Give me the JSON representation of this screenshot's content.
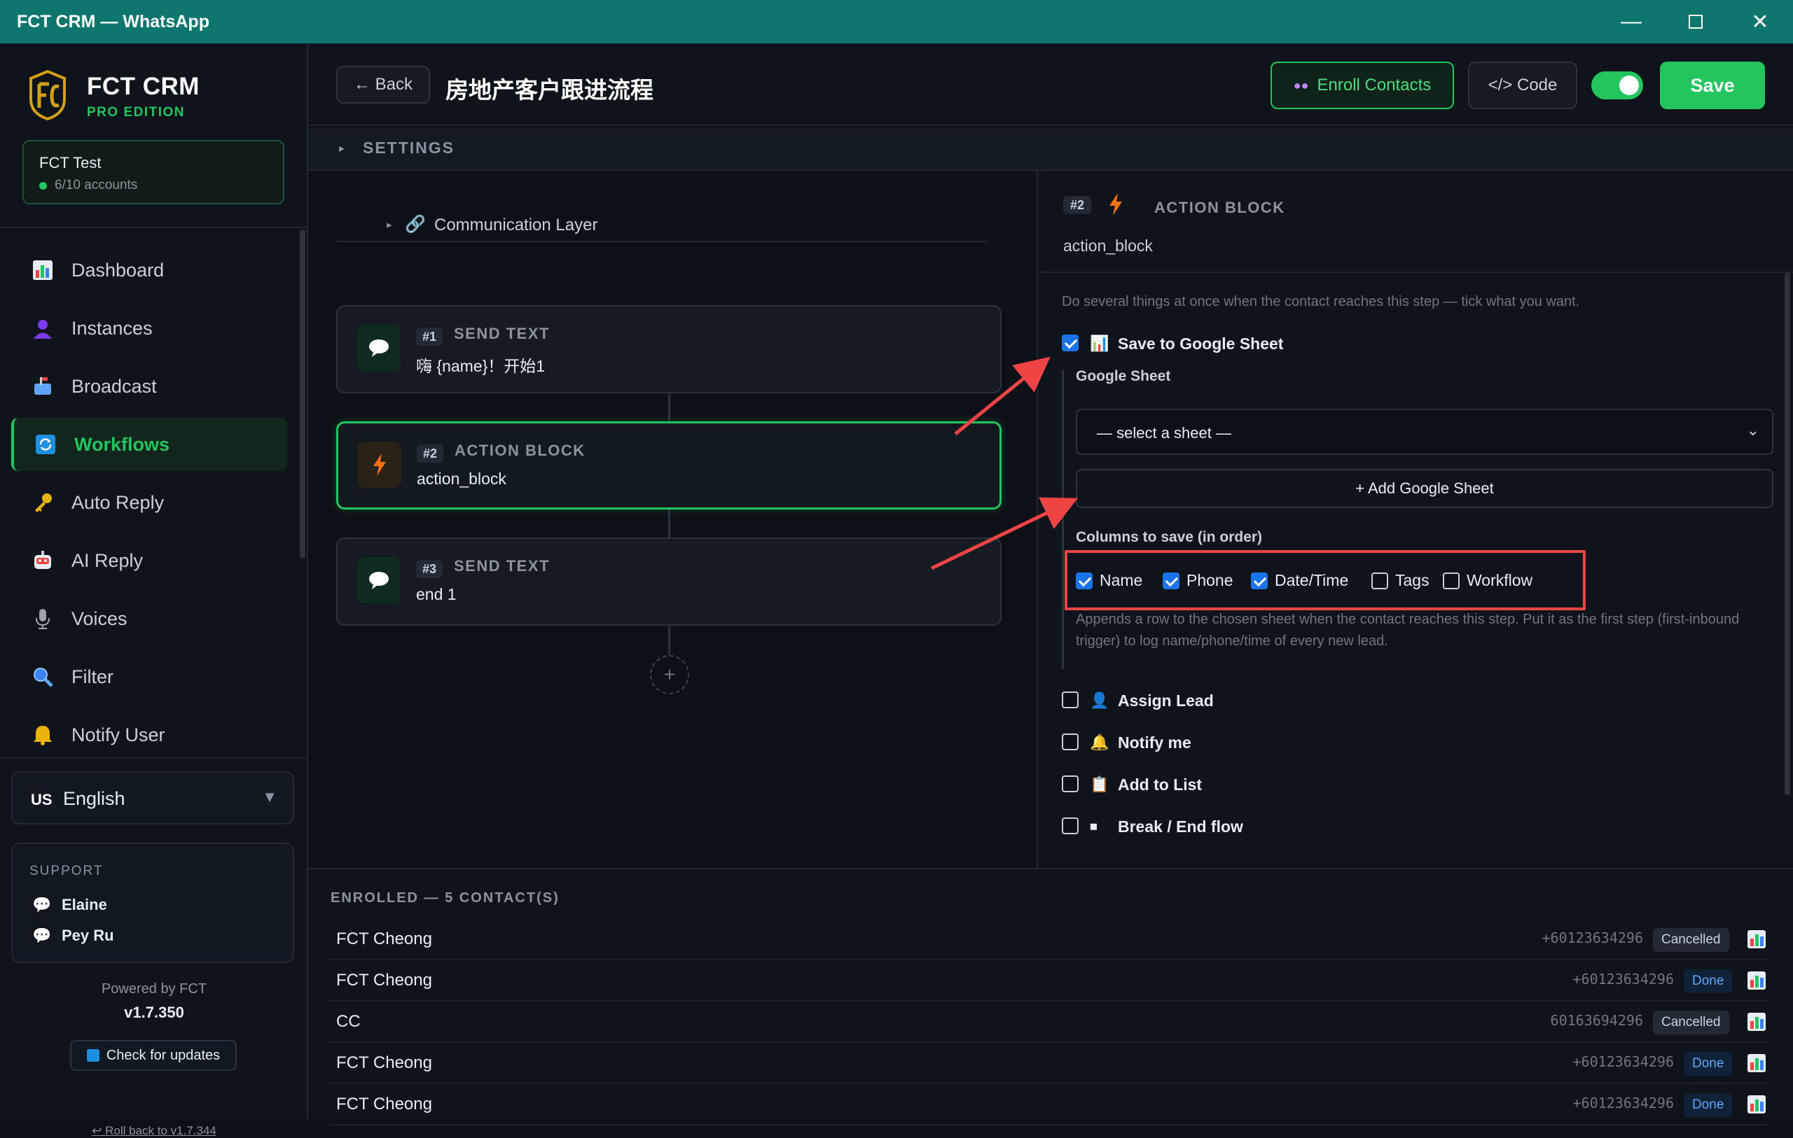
{
  "window": {
    "title": "FCT CRM — WhatsApp"
  },
  "brand": {
    "name": "FCT CRM",
    "edition": "PRO EDITION"
  },
  "account": {
    "name": "FCT Test",
    "count": "6/10 accounts"
  },
  "nav": [
    {
      "label": "Dashboard",
      "icon": "chart-icon"
    },
    {
      "label": "Instances",
      "icon": "user-icon"
    },
    {
      "label": "Broadcast",
      "icon": "mailbox-icon"
    },
    {
      "label": "Workflows",
      "icon": "refresh-icon"
    },
    {
      "label": "Auto Reply",
      "icon": "key-icon"
    },
    {
      "label": "AI Reply",
      "icon": "robot-icon"
    },
    {
      "label": "Voices",
      "icon": "microphone-icon"
    },
    {
      "label": "Filter",
      "icon": "magnifier-icon"
    },
    {
      "label": "Notify User",
      "icon": "bell-icon"
    }
  ],
  "language": {
    "flag": "US",
    "label": "English"
  },
  "support": {
    "heading": "SUPPORT",
    "people": [
      "Elaine",
      "Pey Ru"
    ]
  },
  "footer": {
    "powered": "Powered by FCT",
    "version": "v1.7.350",
    "check_updates": "Check for updates",
    "rollback": "↩ Roll back to v1.7.344"
  },
  "header": {
    "back_label": "← Back",
    "workflow_title": "房地产客户跟进流程",
    "enroll_label": "Enroll Contacts",
    "code_label": "</> Code",
    "save_label": "Save",
    "enabled": true
  },
  "settings": {
    "label": "SETTINGS"
  },
  "canvas": {
    "comm_layer": "Communication Layer",
    "nodes": [
      {
        "num": "#1",
        "type": "SEND TEXT",
        "text": "嗨 {name}！开始1"
      },
      {
        "num": "#2",
        "type": "ACTION BLOCK",
        "text": "action_block"
      },
      {
        "num": "#3",
        "type": "SEND TEXT",
        "text": "end 1"
      }
    ],
    "add_symbol": "+"
  },
  "panel": {
    "num": "#2",
    "type": "ACTION BLOCK",
    "subtitle": "action_block",
    "description": "Do several things at once when the contact reaches this step — tick what you want.",
    "save_to_sheet": {
      "label": "Save to Google Sheet",
      "checked": true
    },
    "sheet_label": "Google Sheet",
    "select_placeholder": "— select a sheet —",
    "add_sheet": "+ Add Google Sheet",
    "columns_label": "Columns to save (in order)",
    "columns": [
      {
        "label": "Name",
        "checked": true
      },
      {
        "label": "Phone",
        "checked": true
      },
      {
        "label": "Date/Time",
        "checked": true
      },
      {
        "label": "Tags",
        "checked": false
      },
      {
        "label": "Workflow",
        "checked": false
      }
    ],
    "note": "Appends a row to the chosen sheet when the contact reaches this step. Put it as the first step (first-inbound trigger) to log name/phone/time of every new lead.",
    "actions": [
      {
        "label": "Assign Lead",
        "checked": false
      },
      {
        "label": "Notify me",
        "checked": false
      },
      {
        "label": "Add to List",
        "checked": false
      },
      {
        "label": "Break / End flow",
        "checked": false
      }
    ]
  },
  "enrolled": {
    "heading": "ENROLLED — 5 CONTACT(S)",
    "rows": [
      {
        "name": "FCT Cheong",
        "phone": "+60123634296",
        "status": "Cancelled"
      },
      {
        "name": "FCT Cheong",
        "phone": "+60123634296",
        "status": "Done"
      },
      {
        "name": "CC",
        "phone": "60163694296",
        "status": "Cancelled"
      },
      {
        "name": "FCT Cheong",
        "phone": "+60123634296",
        "status": "Done"
      },
      {
        "name": "FCT Cheong",
        "phone": "+60123634296",
        "status": "Done"
      }
    ]
  },
  "colors": {
    "accent": "#22c55e",
    "titlebar": "#0f766e",
    "highlight": "#ef4444"
  }
}
